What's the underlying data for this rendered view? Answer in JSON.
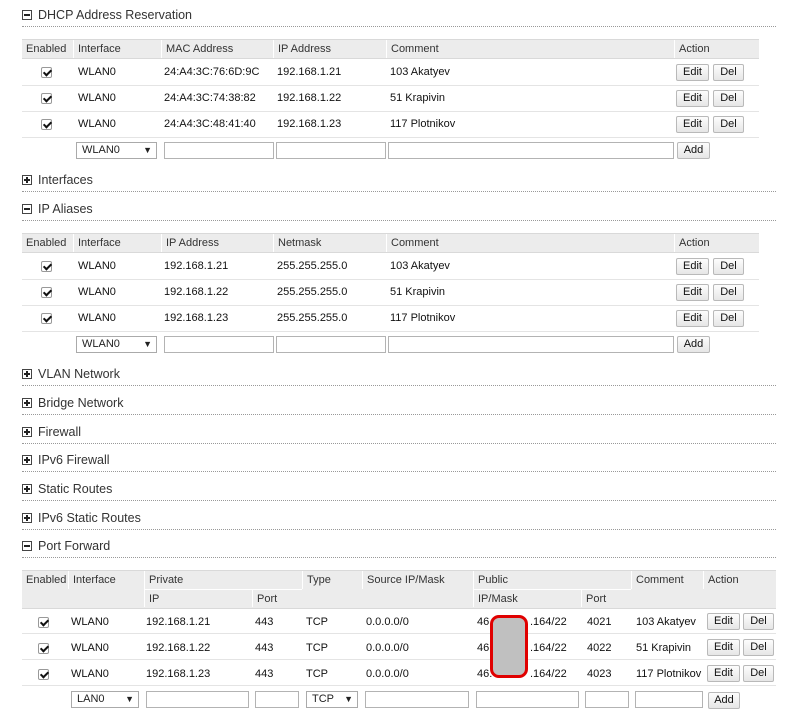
{
  "sections": {
    "dhcp": "DHCP Address Reservation",
    "interfaces": "Interfaces",
    "ip_aliases": "IP Aliases",
    "vlan": "VLAN Network",
    "bridge": "Bridge Network",
    "firewall": "Firewall",
    "ipv6_firewall": "IPv6 Firewall",
    "static_routes": "Static Routes",
    "ipv6_static_routes": "IPv6 Static Routes",
    "port_forward": "Port Forward"
  },
  "dhcp": {
    "headers": [
      "Enabled",
      "Interface",
      "MAC Address",
      "IP Address",
      "Comment",
      "Action"
    ],
    "rows": [
      {
        "iface": "WLAN0",
        "mac": "24:A4:3C:76:6D:9C",
        "ip": "192.168.1.21",
        "comment": "103 Akatyev"
      },
      {
        "iface": "WLAN0",
        "mac": "24:A4:3C:74:38:82",
        "ip": "192.168.1.22",
        "comment": "51 Krapivin"
      },
      {
        "iface": "WLAN0",
        "mac": "24:A4:3C:48:41:40",
        "ip": "192.168.1.23",
        "comment": "117 Plotnikov"
      }
    ],
    "new_iface": "WLAN0"
  },
  "aliases": {
    "headers": [
      "Enabled",
      "Interface",
      "IP Address",
      "Netmask",
      "Comment",
      "Action"
    ],
    "rows": [
      {
        "iface": "WLAN0",
        "ip": "192.168.1.21",
        "mask": "255.255.255.0",
        "comment": "103 Akatyev"
      },
      {
        "iface": "WLAN0",
        "ip": "192.168.1.22",
        "mask": "255.255.255.0",
        "comment": "51 Krapivin"
      },
      {
        "iface": "WLAN0",
        "ip": "192.168.1.23",
        "mask": "255.255.255.0",
        "comment": "117 Plotnikov"
      }
    ],
    "new_iface": "WLAN0"
  },
  "portfwd": {
    "headers": [
      "Enabled",
      "Interface",
      "Private",
      "Type",
      "Source IP/Mask",
      "Public",
      "Comment",
      "Action"
    ],
    "subheaders": [
      "IP",
      "Port",
      "IP/Mask",
      "Port"
    ],
    "rows": [
      {
        "iface": "WLAN0",
        "ip": "192.168.1.21",
        "port": "443",
        "type": "TCP",
        "src": "0.0.0.0/0",
        "pub_a": "46.",
        "pub_b": ".164/22",
        "pub_port": "4021",
        "comment": "103 Akatyev"
      },
      {
        "iface": "WLAN0",
        "ip": "192.168.1.22",
        "port": "443",
        "type": "TCP",
        "src": "0.0.0.0/0",
        "pub_a": "46.",
        "pub_b": ".164/22",
        "pub_port": "4022",
        "comment": "51 Krapivin"
      },
      {
        "iface": "WLAN0",
        "ip": "192.168.1.23",
        "port": "443",
        "type": "TCP",
        "src": "0.0.0.0/0",
        "pub_a": "46.",
        "pub_b": ".164/22",
        "pub_port": "4023",
        "comment": "117 Plotnikov"
      }
    ],
    "new_iface": "LAN0",
    "new_type": "TCP"
  },
  "labels": {
    "edit": "Edit",
    "del": "Del",
    "add": "Add"
  }
}
